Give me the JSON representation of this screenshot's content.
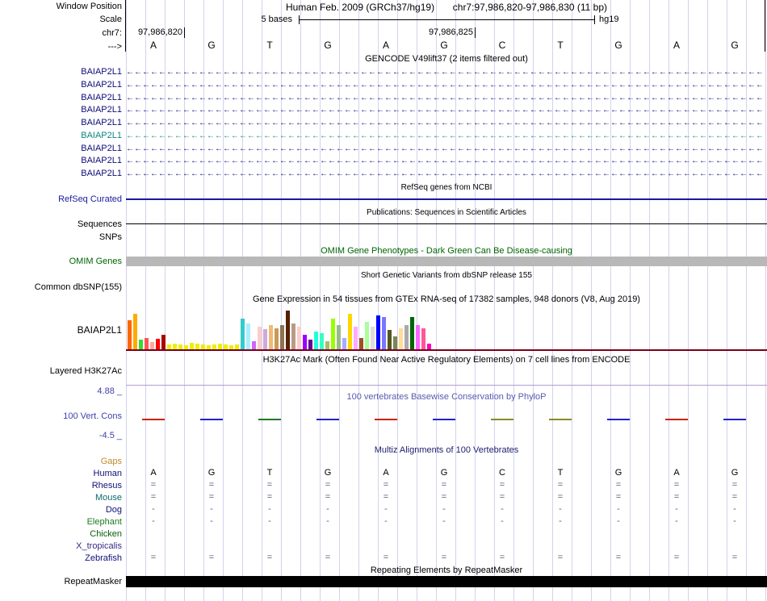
{
  "header": {
    "window_position_label": "Window Position",
    "assembly": "Human Feb. 2009 (GRCh37/hg19)",
    "position": "chr7:97,986,820-97,986,830 (11 bp)",
    "scale_label": "Scale",
    "scale_value": "5 bases",
    "genome": "hg19",
    "chrom_label": "chr7:",
    "coord_ticks": [
      "97,986,820",
      "97,986,825"
    ],
    "strand_label": "--->"
  },
  "ruler_bases": [
    "A",
    "G",
    "T",
    "G",
    "A",
    "G",
    "C",
    "T",
    "G",
    "A",
    "G"
  ],
  "gencode": {
    "title": "GENCODE V49lift37 (2 items filtered out)",
    "items": [
      {
        "label": "BAIAP2L1",
        "color": "#0c0c78"
      },
      {
        "label": "BAIAP2L1",
        "color": "#0c0c78"
      },
      {
        "label": "BAIAP2L1",
        "color": "#0c0c78"
      },
      {
        "label": "BAIAP2L1",
        "color": "#0c0c78"
      },
      {
        "label": "BAIAP2L1",
        "color": "#0c0c78"
      },
      {
        "label": "BAIAP2L1",
        "color": "#0b8583"
      },
      {
        "label": "BAIAP2L1",
        "color": "#0c0c78"
      },
      {
        "label": "BAIAP2L1",
        "color": "#0c0c78"
      },
      {
        "label": "BAIAP2L1",
        "color": "#0c0c78"
      }
    ]
  },
  "refseq": {
    "title": "RefSeq genes from NCBI",
    "label": "RefSeq Curated",
    "color": "#1a1a9c"
  },
  "publications": {
    "title": "Publications: Sequences in Scientific Articles",
    "label": "Sequences"
  },
  "snps": {
    "label": "SNPs"
  },
  "omim": {
    "title": "OMIM Gene Phenotypes - Dark Green Can Be Disease-causing",
    "label": "OMIM Genes",
    "color": "#006400",
    "bar_color": "#b8b8b8"
  },
  "dbsnp": {
    "title": "Short Genetic Variants from dbSNP release 155",
    "label": "Common dbSNP(155)"
  },
  "gtex": {
    "title": "Gene Expression in 54 tissues from GTEx RNA-seq of 17382 samples, 948 donors (V8, Aug 2019)",
    "label": "BAIAP2L1",
    "baseline_color": "#7a0019"
  },
  "h3k27ac": {
    "title": "H3K27Ac Mark (Often Found Near Active Regulatory Elements) on 7 cell lines from ENCODE",
    "label": "Layered H3K27Ac",
    "line_color": "#b39dd0"
  },
  "conservation": {
    "title": "100 vertebrates Basewise Conservation by PhyloP",
    "label": "100 Vert. Cons",
    "max_label": "4.88 _",
    "min_label": "-4.5 _",
    "color": "#3f3fb0",
    "title_color": "#5a5ab0",
    "mark_colors": [
      "#cc2200",
      "#2222cc",
      "#227722",
      "#2222cc",
      "#cc2200",
      "#2222cc",
      "#8a8a22",
      "#8a8a22",
      "#2222cc",
      "#cc2200",
      "#2222cc"
    ]
  },
  "multiz": {
    "title": "Multiz Alignments of 100 Vertebrates",
    "title_color": "#21216e",
    "rows": [
      {
        "label": "Gaps",
        "color": "#c08a2e",
        "cells": [
          "",
          "",
          "",
          "",
          "",
          "",
          "",
          "",
          "",
          "",
          ""
        ]
      },
      {
        "label": "Human",
        "color": "#101078",
        "cells": [
          "A",
          "G",
          "T",
          "G",
          "A",
          "G",
          "C",
          "T",
          "G",
          "A",
          "G"
        ]
      },
      {
        "label": "Rhesus",
        "color": "#101078",
        "cells": [
          "=",
          "=",
          "=",
          "=",
          "=",
          "=",
          "=",
          "=",
          "=",
          "=",
          "="
        ]
      },
      {
        "label": "Mouse",
        "color": "#0e6a6a",
        "cells": [
          "=",
          "=",
          "=",
          "=",
          "=",
          "=",
          "=",
          "=",
          "=",
          "=",
          "="
        ]
      },
      {
        "label": "Dog",
        "color": "#101078",
        "cells": [
          "-",
          "-",
          "-",
          "-",
          "-",
          "-",
          "-",
          "-",
          "-",
          "-",
          "-"
        ]
      },
      {
        "label": "Elephant",
        "color": "#1e7a1e",
        "cells": [
          "-",
          "-",
          "-",
          "-",
          "-",
          "-",
          "-",
          "-",
          "-",
          "-",
          "-"
        ]
      },
      {
        "label": "Chicken",
        "color": "#0b5e0b",
        "cells": [
          "",
          "",
          "",
          "",
          "",
          "",
          "",
          "",
          "",
          "",
          ""
        ]
      },
      {
        "label": "X_tropicalis",
        "color": "#3a2a86",
        "cells": [
          "",
          "",
          "",
          "",
          "",
          "",
          "",
          "",
          "",
          "",
          ""
        ]
      },
      {
        "label": "Zebrafish",
        "color": "#101078",
        "cells": [
          "=",
          "=",
          "=",
          "=",
          "=",
          "=",
          "=",
          "=",
          "=",
          "=",
          "="
        ]
      }
    ]
  },
  "repeatmasker": {
    "title": "Repeating Elements by RepeatMasker",
    "label": "RepeatMasker"
  },
  "chart_data": {
    "type": "bar",
    "title": "Gene Expression in 54 tissues from GTEx RNA-seq of 17382 samples, 948 donors (V8, Aug 2019)",
    "gene": "BAIAP2L1",
    "n_bars": 54,
    "ylabel": "expression (axis unlabeled in image; values are bar heights in px)",
    "colors": [
      "#FF6600",
      "#FFAA00",
      "#33DD33",
      "#FF5555",
      "#FFAA99",
      "#FF0000",
      "#AA0000",
      "#EEEE00",
      "#EEEE00",
      "#EEEE00",
      "#EEEE00",
      "#EEEE00",
      "#EEEE00",
      "#EEEE00",
      "#EEEE00",
      "#EEEE00",
      "#EEEE00",
      "#EEEE00",
      "#EEEE00",
      "#EEEE00",
      "#33CCCC",
      "#AAEEFF",
      "#CC66FF",
      "#FFCCCC",
      "#CCAADD",
      "#EEBB77",
      "#CC9955",
      "#8B7355",
      "#552200",
      "#BB9988",
      "#FFCCCC",
      "#9900FF",
      "#660099",
      "#22FFDD",
      "#33FFC2",
      "#AABB66",
      "#99FF00",
      "#99BB88",
      "#AAAAFF",
      "#FFD700",
      "#FFAAFF",
      "#995522",
      "#AAFF99",
      "#DDDDDD",
      "#0000FF",
      "#7777FF",
      "#555522",
      "#778855",
      "#FFDD99",
      "#AAAAAA",
      "#006600",
      "#FF66FF",
      "#FF5599",
      "#FF00BB"
    ],
    "values": [
      36,
      44,
      12,
      14,
      9,
      13,
      18,
      6,
      7,
      6,
      5,
      8,
      7,
      6,
      5,
      6,
      7,
      6,
      5,
      6,
      38,
      32,
      10,
      28,
      25,
      30,
      26,
      30,
      48,
      32,
      28,
      18,
      12,
      22,
      20,
      10,
      38,
      30,
      14,
      44,
      28,
      14,
      34,
      28,
      42,
      40,
      24,
      16,
      26,
      30,
      40,
      30,
      26,
      7
    ]
  }
}
